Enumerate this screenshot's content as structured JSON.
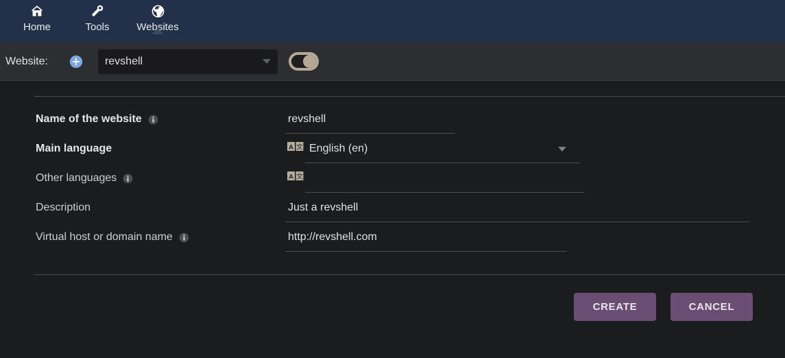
{
  "topnav": {
    "items": [
      {
        "label": "Home",
        "icon": "home-icon",
        "active": false
      },
      {
        "label": "Tools",
        "icon": "wrench-icon",
        "active": false
      },
      {
        "label": "Websites",
        "icon": "globe-icon",
        "active": true
      }
    ],
    "background_color": "#22304a"
  },
  "selector": {
    "label": "Website:",
    "add_icon": "plus-circle-icon",
    "selected_website": "revshell",
    "dropdown_icon": "chevron-down-icon",
    "toggle_icon": "toggle-switch-icon",
    "toggle_state": "on",
    "toggle_color": "#b6a896"
  },
  "form": {
    "rows": [
      {
        "label": "Name of the website",
        "bold": true,
        "has_info": true,
        "info_icon": "info-icon",
        "value": "revshell",
        "type": "text"
      },
      {
        "label": "Main language",
        "bold": true,
        "has_info": false,
        "value": "English (en)",
        "type": "select",
        "lang_icon": "translate-icon",
        "dropdown_icon": "chevron-down-icon"
      },
      {
        "label": "Other languages",
        "bold": false,
        "has_info": true,
        "info_icon": "info-icon",
        "value": "",
        "type": "lang-multi",
        "lang_icon": "translate-icon"
      },
      {
        "label": "Description",
        "bold": false,
        "has_info": false,
        "value": "Just a revshell",
        "type": "text"
      },
      {
        "label": "Virtual host or domain name",
        "bold": false,
        "has_info": true,
        "info_icon": "info-icon",
        "value": "http://revshell.com",
        "type": "text"
      }
    ]
  },
  "actions": {
    "create_label": "CREATE",
    "cancel_label": "CANCEL",
    "button_color": "#6b4c72"
  }
}
